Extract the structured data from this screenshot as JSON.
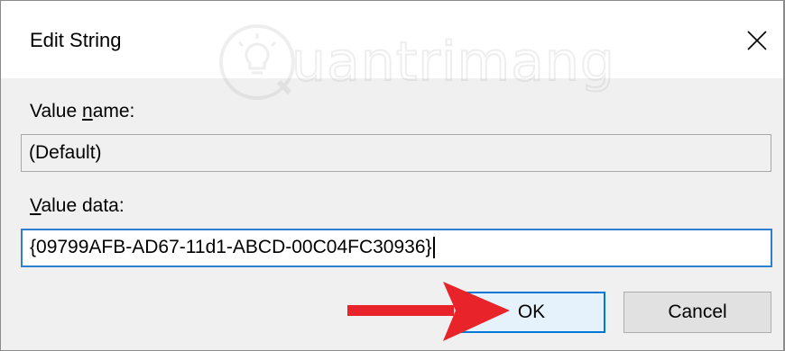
{
  "dialog": {
    "title": "Edit String",
    "close_icon": "close-icon"
  },
  "watermark": {
    "text": "uantrimang",
    "icon": "lightbulb-icon"
  },
  "value_name": {
    "label_prefix": "Value ",
    "label_accel": "n",
    "label_suffix": "ame:",
    "value": "(Default)"
  },
  "value_data": {
    "label_accel": "V",
    "label_suffix": "alue data:",
    "value": "{09799AFB-AD67-11d1-ABCD-00C04FC30936}"
  },
  "buttons": {
    "ok_label": "OK",
    "cancel_label": "Cancel"
  },
  "annotation": {
    "arrow_color": "#e8232a",
    "accent_color": "#0078d7"
  }
}
